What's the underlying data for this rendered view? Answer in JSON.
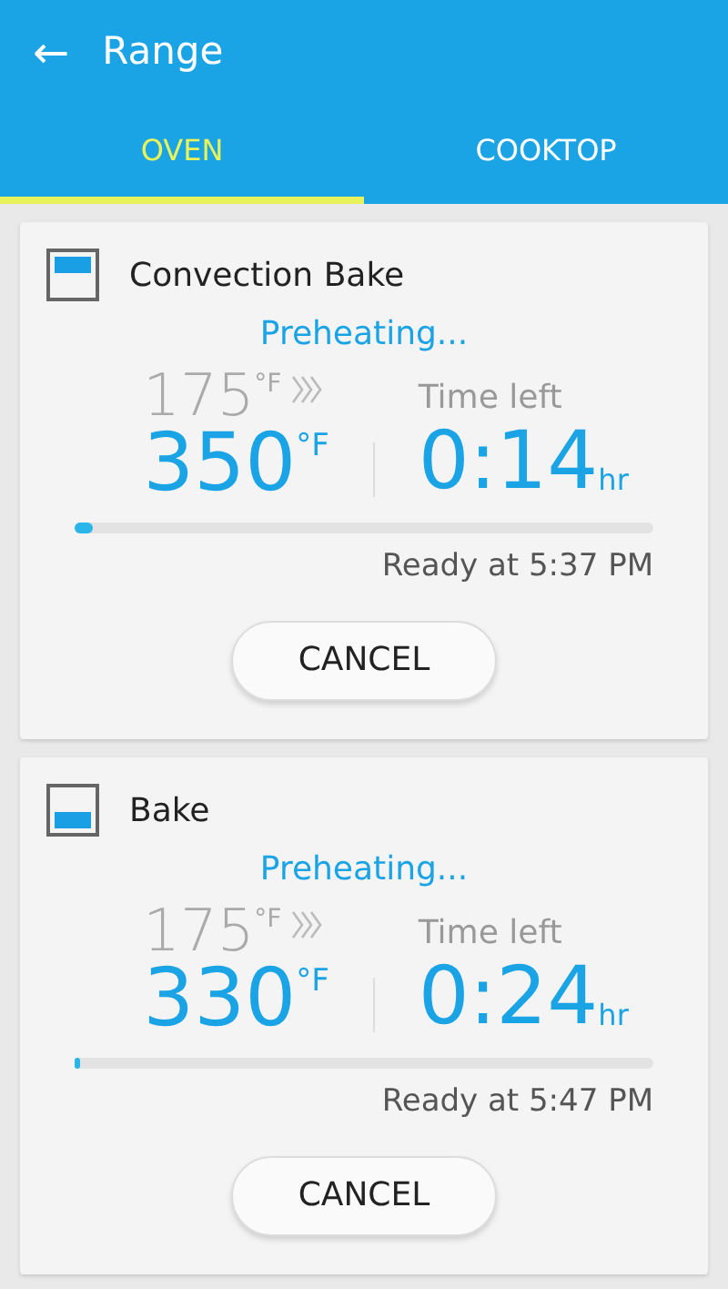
{
  "app_bar": {
    "back": "←",
    "title": "Range"
  },
  "tabs": [
    {
      "label": "OVEN",
      "selected": true
    },
    {
      "label": "COOKTOP",
      "selected": false
    }
  ],
  "modes": [
    {
      "kind": "top",
      "name": "Convection Bake",
      "status": "Preheating...",
      "current_temp": "175",
      "current_unit": "°F",
      "target_temp": "350",
      "target_unit": "°F",
      "time_label": "Time left",
      "time": "0:14",
      "time_unit": "hr",
      "level": 0.03,
      "ready": "Ready at 5:37 PM",
      "cancel": "CANCEL"
    },
    {
      "kind": "bottom",
      "name": "Bake",
      "status": "Preheating...",
      "current_temp": "175",
      "current_unit": "°F",
      "target_temp": "330",
      "target_unit": "°F",
      "time_label": "Time left",
      "time": "0:24",
      "time_unit": "hr",
      "level": 0.005,
      "ready": "Ready at 5:47 PM",
      "cancel": "CANCEL"
    }
  ]
}
